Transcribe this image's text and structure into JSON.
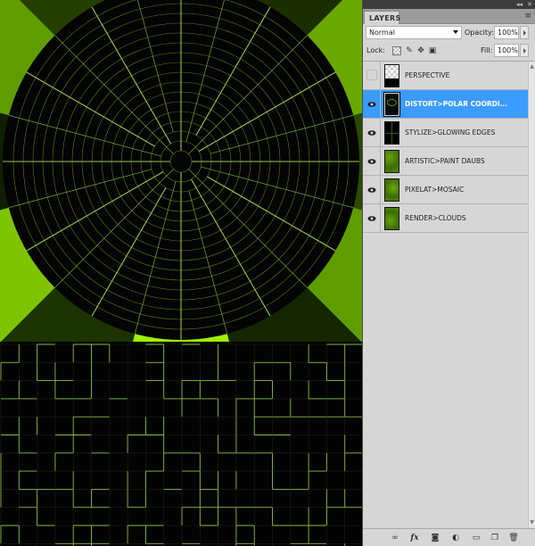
{
  "panel": {
    "collapse_glyph": "◂◂",
    "close_glyph": "✕",
    "tab_label": "LAYERS",
    "menu_icon": "≡",
    "blend_mode": "Normal",
    "opacity_label": "Opacity:",
    "opacity_value": "100%",
    "lock_label": "Lock:",
    "fill_label": "Fill:",
    "fill_value": "100%",
    "lock_icons": [
      "lock-transparent-icon",
      "lock-paint-icon",
      "lock-move-icon",
      "lock-all-icon"
    ]
  },
  "layers": [
    {
      "name": "PERSPECTIVE",
      "visible": false,
      "selected": false,
      "thumb": "transparent"
    },
    {
      "name": "DISTORT>POLAR COORDI...",
      "visible": true,
      "selected": true,
      "thumb": "polar"
    },
    {
      "name": "STYLIZE>GLOWING EDGES",
      "visible": true,
      "selected": false,
      "thumb": "edges"
    },
    {
      "name": "ARTISTIC>PAINT DAUBS",
      "visible": true,
      "selected": false,
      "thumb": "green"
    },
    {
      "name": "PIXELAT>MOSAIC",
      "visible": true,
      "selected": false,
      "thumb": "green"
    },
    {
      "name": "RENDER>CLOUDS",
      "visible": true,
      "selected": false,
      "thumb": "green"
    }
  ],
  "bottom_bar": {
    "icons": [
      "link-layers-icon",
      "fx-icon",
      "add-mask-icon",
      "adjustment-layer-icon",
      "new-group-icon",
      "new-layer-icon",
      "delete-layer-icon"
    ],
    "fx_label": "fx"
  },
  "colors": {
    "accent_selected": "#3b9bff",
    "glow_green": "#b4e65a",
    "bright_green": "#9ef000",
    "mid_green": "#5f9c00",
    "dark_green": "#2a4a00"
  }
}
